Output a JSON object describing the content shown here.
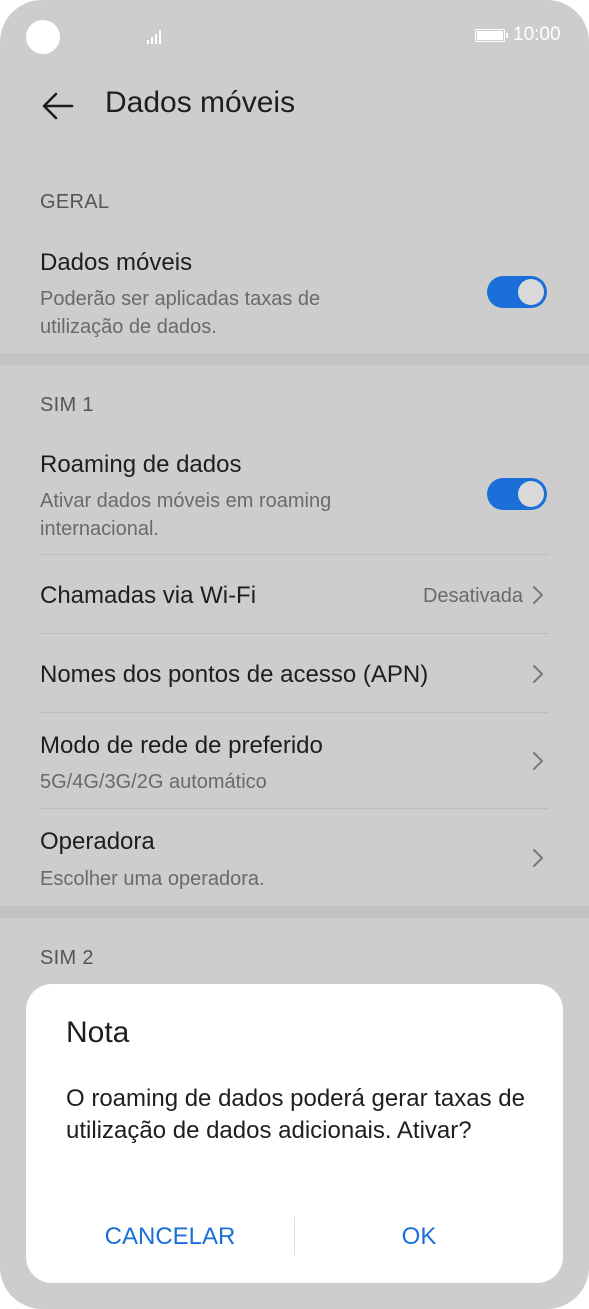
{
  "status_bar": {
    "time": "10:00",
    "battery_icon": "battery-full-icon",
    "signal_icon": "signal-icon"
  },
  "header": {
    "back_icon": "arrow-left-icon",
    "title": "Dados móveis"
  },
  "sections": {
    "geral": {
      "header": "GERAL",
      "mobile_data": {
        "title": "Dados móveis",
        "subtitle": "Poderão ser aplicadas taxas de utilização de dados.",
        "toggle_on": true
      }
    },
    "sim1": {
      "header": "SIM 1",
      "roaming": {
        "title": "Roaming de dados",
        "subtitle": "Ativar dados móveis em roaming internacional.",
        "toggle_on": true
      },
      "wifi_calls": {
        "title": "Chamadas via Wi-Fi",
        "value": "Desativada"
      },
      "apn": {
        "title": "Nomes dos pontos de acesso (APN)"
      },
      "network_mode": {
        "title": "Modo de rede de preferido",
        "subtitle": "5G/4G/3G/2G automático"
      },
      "operator": {
        "title": "Operadora",
        "subtitle": "Escolher uma operadora."
      }
    },
    "sim2": {
      "header": "SIM 2"
    }
  },
  "dialog": {
    "title": "Nota",
    "message": "O roaming de dados poderá gerar taxas de utilização de dados adicionais. Ativar?",
    "cancel_label": "CANCELAR",
    "ok_label": "OK"
  },
  "colors": {
    "accent": "#1a6fd8",
    "background": "#cdcdcd",
    "dialog": "#ffffff"
  }
}
